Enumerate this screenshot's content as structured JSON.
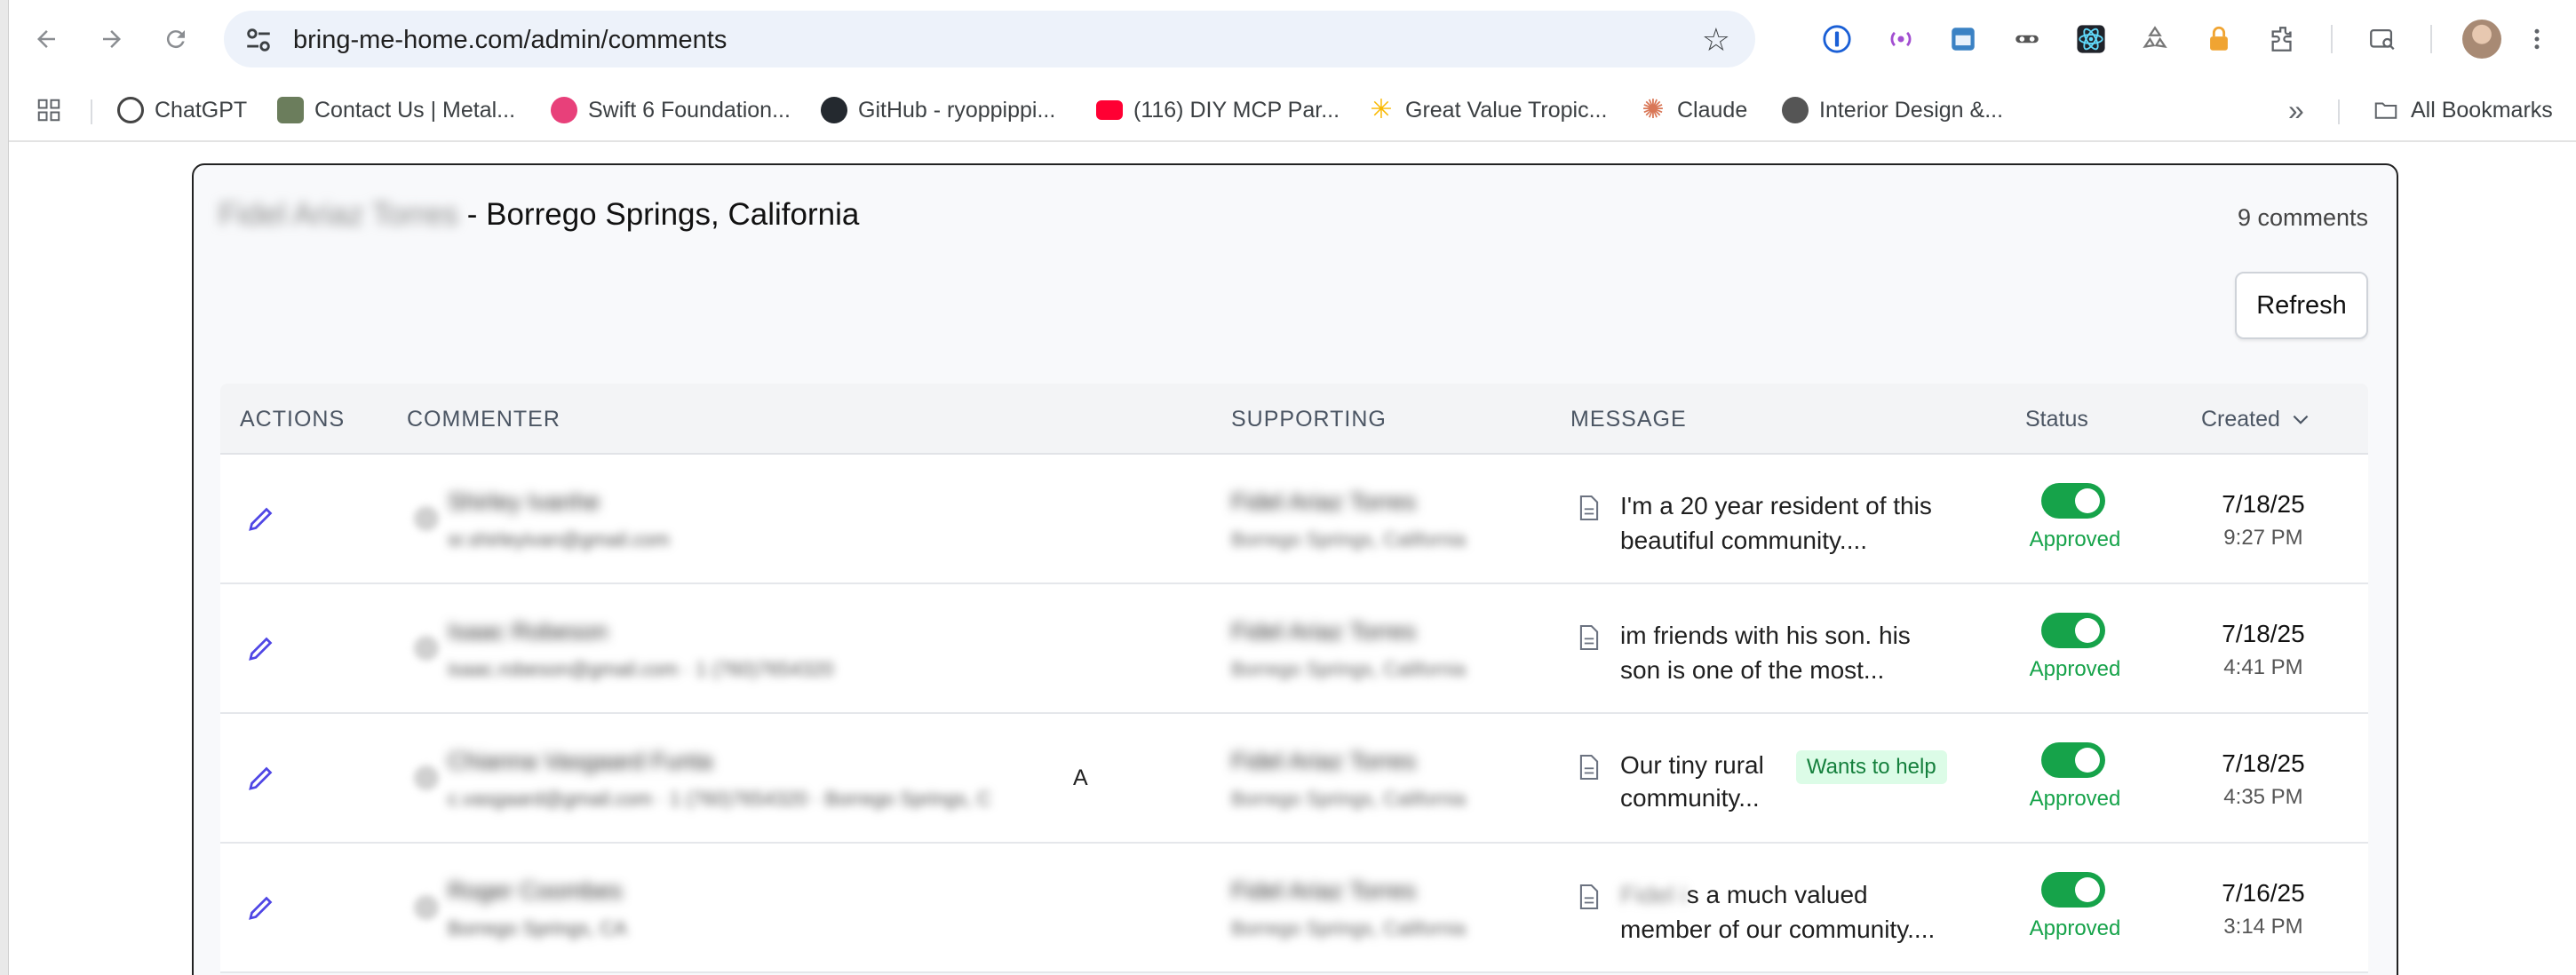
{
  "browser": {
    "url": "bring-me-home.com/admin/comments",
    "bookmarks": [
      {
        "label": "ChatGPT",
        "color": "#444444"
      },
      {
        "label": "Contact Us | Metal...",
        "color": "#6b7d5c"
      },
      {
        "label": "Swift 6 Foundation...",
        "color": "#e8407a"
      },
      {
        "label": "GitHub - ryoppippi...",
        "color": "#24292f"
      },
      {
        "label": "(116) DIY MCP Par...",
        "color": "#ff0033"
      },
      {
        "label": "Great Value Tropic...",
        "color": "#f9b800"
      },
      {
        "label": "Claude",
        "color": "#d97757"
      },
      {
        "label": "Interior Design &...",
        "color": "#555555"
      }
    ],
    "all_bookmarks": "All Bookmarks",
    "overflow": "»"
  },
  "card": {
    "title_name": "Fidel Ariaz Torres",
    "title_location": "- Borrego Springs, California",
    "count": "9 comments",
    "refresh_label": "Refresh"
  },
  "table": {
    "headers": {
      "actions": "ACTIONS",
      "commenter": "COMMENTER",
      "supporting": "SUPPORTING",
      "message": "MESSAGE",
      "status": "Status",
      "created": "Created"
    },
    "rows": [
      {
        "commenter_name": "Shirley Ivanhe",
        "commenter_sub": "sr.shirleyivan@gmail.com",
        "supporting_name": "Fidel Ariaz Torres",
        "supporting_loc": "Borrego Springs, California",
        "message_line1": "I'm a 20 year resident of this",
        "message_line2": "beautiful community....",
        "tag": "",
        "status": "Approved",
        "date": "7/18/25",
        "time": "9:27 PM"
      },
      {
        "commenter_name": "Isaac Robeson",
        "commenter_sub": "isaac.robeson@gmail.com · 1 (760)7654320",
        "supporting_name": "Fidel Ariaz Torres",
        "supporting_loc": "Borrego Springs, California",
        "message_line1": "im friends with his son. his",
        "message_line2": "son is one of the most...",
        "tag": "",
        "status": "Approved",
        "date": "7/18/25",
        "time": "4:41 PM"
      },
      {
        "commenter_name": "Chianna Vasgaard Funta",
        "commenter_sub": "c.vasgaard@gmail.com · 1 (760)7654320 · Borrego Springs, C",
        "commenter_tail": "A",
        "supporting_name": "Fidel Ariaz Torres",
        "supporting_loc": "Borrego Springs, California",
        "message_line1": "Our tiny rural",
        "message_line2": "community...",
        "tag": "Wants to help",
        "status": "Approved",
        "date": "7/18/25",
        "time": "4:35 PM"
      },
      {
        "commenter_name": "Roger Coombes",
        "commenter_sub": "Borrego Springs, CA",
        "supporting_name": "Fidel Ariaz Torres",
        "supporting_loc": "Borrego Springs, California",
        "message_prefix": "Fidel i",
        "message_line1": "s a much valued",
        "message_line2": "member of our community....",
        "tag": "",
        "status": "Approved",
        "date": "7/16/25",
        "time": "3:14 PM"
      }
    ]
  }
}
